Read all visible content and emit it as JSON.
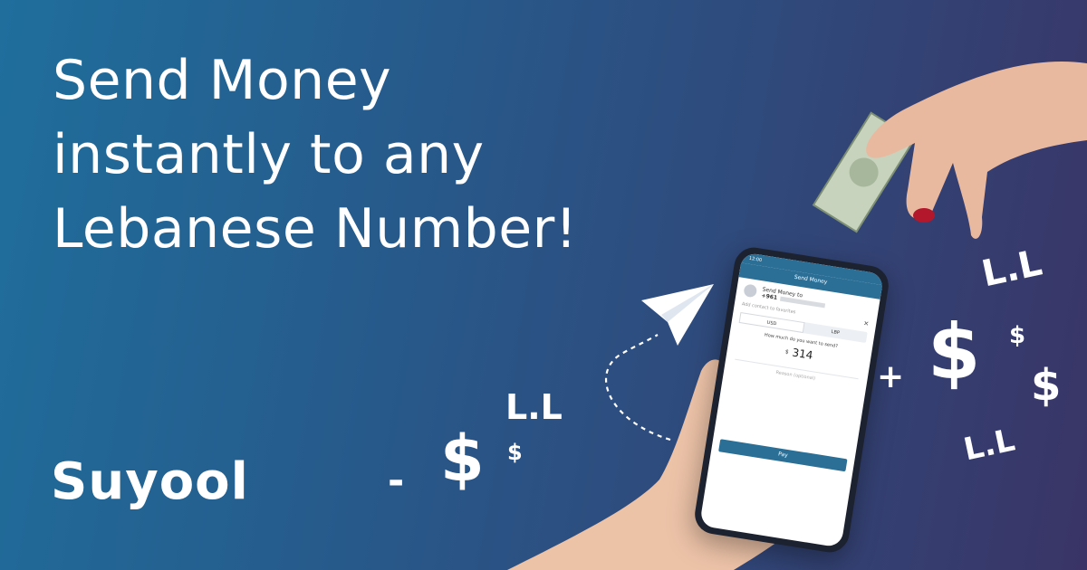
{
  "headline": {
    "line1": "Send Money",
    "line2": "instantly to any",
    "line3": "Lebanese Number!"
  },
  "logo": {
    "text": "Suyool"
  },
  "decor": {
    "minus": "-",
    "plus": "+",
    "dollar": "$",
    "lira": "L.L"
  },
  "phone": {
    "status_time": "12:00",
    "title": "Send Money",
    "send_to_label": "Send Money to",
    "country_code": "+961",
    "add_contact": "Add contact to favorites",
    "currency_left": "USD",
    "currency_right": "LBP",
    "question": "How much do you want to send?",
    "amount_currency": "$",
    "amount": "314",
    "reason_placeholder": "Reason (optional)",
    "pay_label": "Pay"
  },
  "colors": {
    "bg_start": "#1f6e9c",
    "bg_end": "#3a3466",
    "accent": "#2b6f97"
  }
}
